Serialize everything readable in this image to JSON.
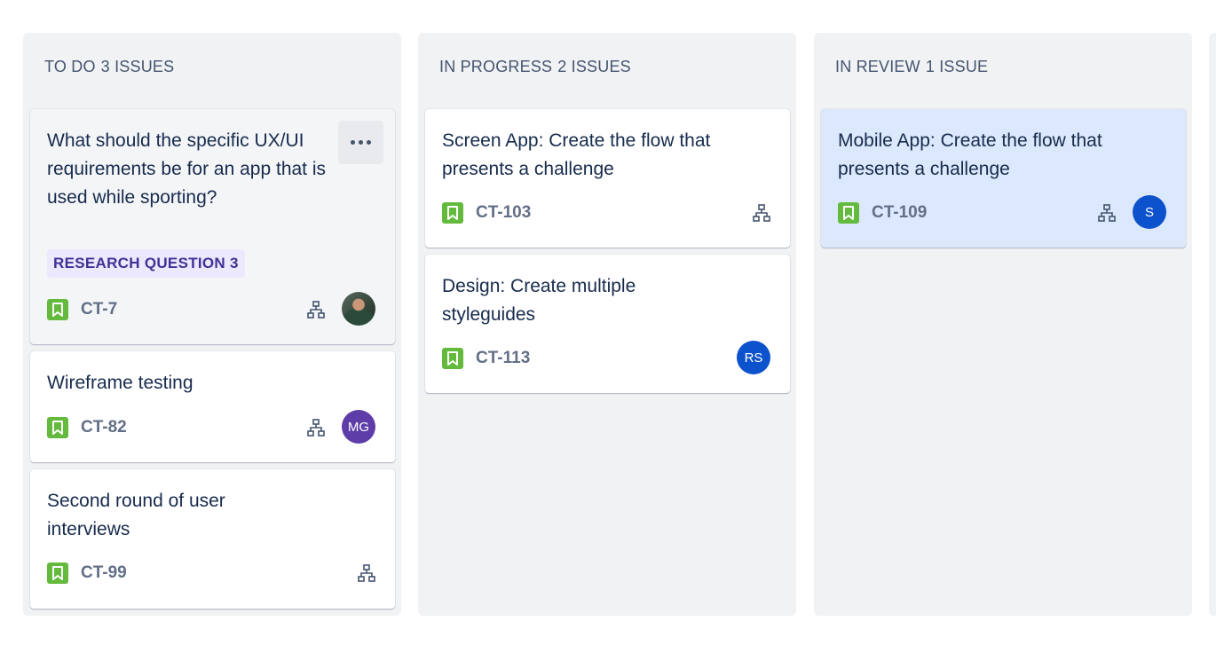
{
  "colors": {
    "column_bg": "#f1f2f4",
    "story_green": "#63ba3c",
    "label_bg": "#ece8fd",
    "label_text": "#403294",
    "selected_card_bg": "#dce8fb",
    "avatar_purple": "#5e3da8",
    "avatar_blue": "#0c52cc"
  },
  "columns": [
    {
      "title": "TO DO",
      "count": "3 ISSUES",
      "cards": [
        {
          "title": "What should the specific UX/UI requirements be for an app that is used while sporting?",
          "label": "RESEARCH QUESTION 3",
          "key": "CT-7",
          "type_icon": "story-icon",
          "has_more_menu": true,
          "assignee": {
            "kind": "photo",
            "initials": ""
          }
        },
        {
          "title": "Wireframe testing",
          "key": "CT-82",
          "type_icon": "story-icon",
          "assignee": {
            "kind": "initials",
            "initials": "MG"
          }
        },
        {
          "title": "Second round of user interviews",
          "key": "CT-99",
          "type_icon": "story-icon"
        }
      ]
    },
    {
      "title": "IN PROGRESS",
      "count": "2 ISSUES",
      "cards": [
        {
          "title": "Screen App: Create the flow that presents a challenge",
          "key": "CT-103",
          "type_icon": "story-icon"
        },
        {
          "title": "Design: Create multiple styleguides",
          "key": "CT-113",
          "type_icon": "story-icon",
          "assignee": {
            "kind": "initials",
            "initials": "RS"
          }
        }
      ]
    },
    {
      "title": "IN REVIEW",
      "count": "1 ISSUE",
      "cards": [
        {
          "title": "Mobile App: Create the flow that presents a challenge",
          "key": "CT-109",
          "type_icon": "story-icon",
          "selected": true,
          "assignee": {
            "kind": "initials",
            "initials": "S"
          }
        }
      ]
    }
  ]
}
